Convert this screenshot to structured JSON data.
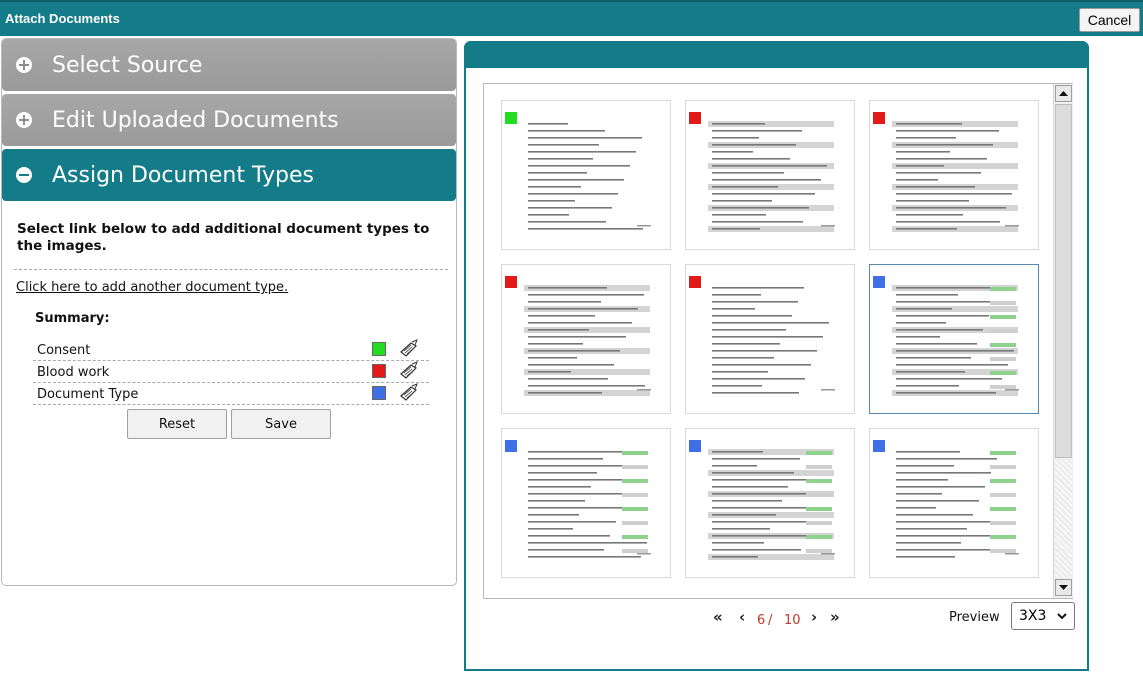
{
  "window": {
    "title": "Attach Documents",
    "cancel_label": "Cancel"
  },
  "accordion": {
    "sections": [
      {
        "label": "Select Source",
        "expanded": false
      },
      {
        "label": "Edit Uploaded Documents",
        "expanded": false
      },
      {
        "label": "Assign Document Types",
        "expanded": true
      }
    ]
  },
  "assign": {
    "instructions": "Select link below to add additional document types to the images.",
    "add_link": "Click here to add another document type.",
    "summary_label": "Summary:",
    "summary": [
      {
        "name": "Consent",
        "color": "#22dd22",
        "icon": "edit-document-icon"
      },
      {
        "name": "Blood work",
        "color": "#e21a1a",
        "icon": "edit-document-icon"
      },
      {
        "name": "Document Type",
        "color": "#3f6fe6",
        "icon": "edit-document-icon"
      }
    ],
    "reset_label": "Reset",
    "save_label": "Save"
  },
  "preview": {
    "thumbnails": [
      {
        "marker_color": "#22dd22",
        "selected": false
      },
      {
        "marker_color": "#e21a1a",
        "selected": false
      },
      {
        "marker_color": "#e21a1a",
        "selected": false
      },
      {
        "marker_color": "#e21a1a",
        "selected": false
      },
      {
        "marker_color": "#e21a1a",
        "selected": false
      },
      {
        "marker_color": "#3f6fe6",
        "selected": true
      },
      {
        "marker_color": "#3f6fe6",
        "selected": false
      },
      {
        "marker_color": "#3f6fe6",
        "selected": false
      },
      {
        "marker_color": "#3f6fe6",
        "selected": false
      }
    ],
    "pagination": {
      "current": "6",
      "separator": "/",
      "total": "10"
    },
    "preview_label": "Preview",
    "grid_option": "3X3"
  }
}
